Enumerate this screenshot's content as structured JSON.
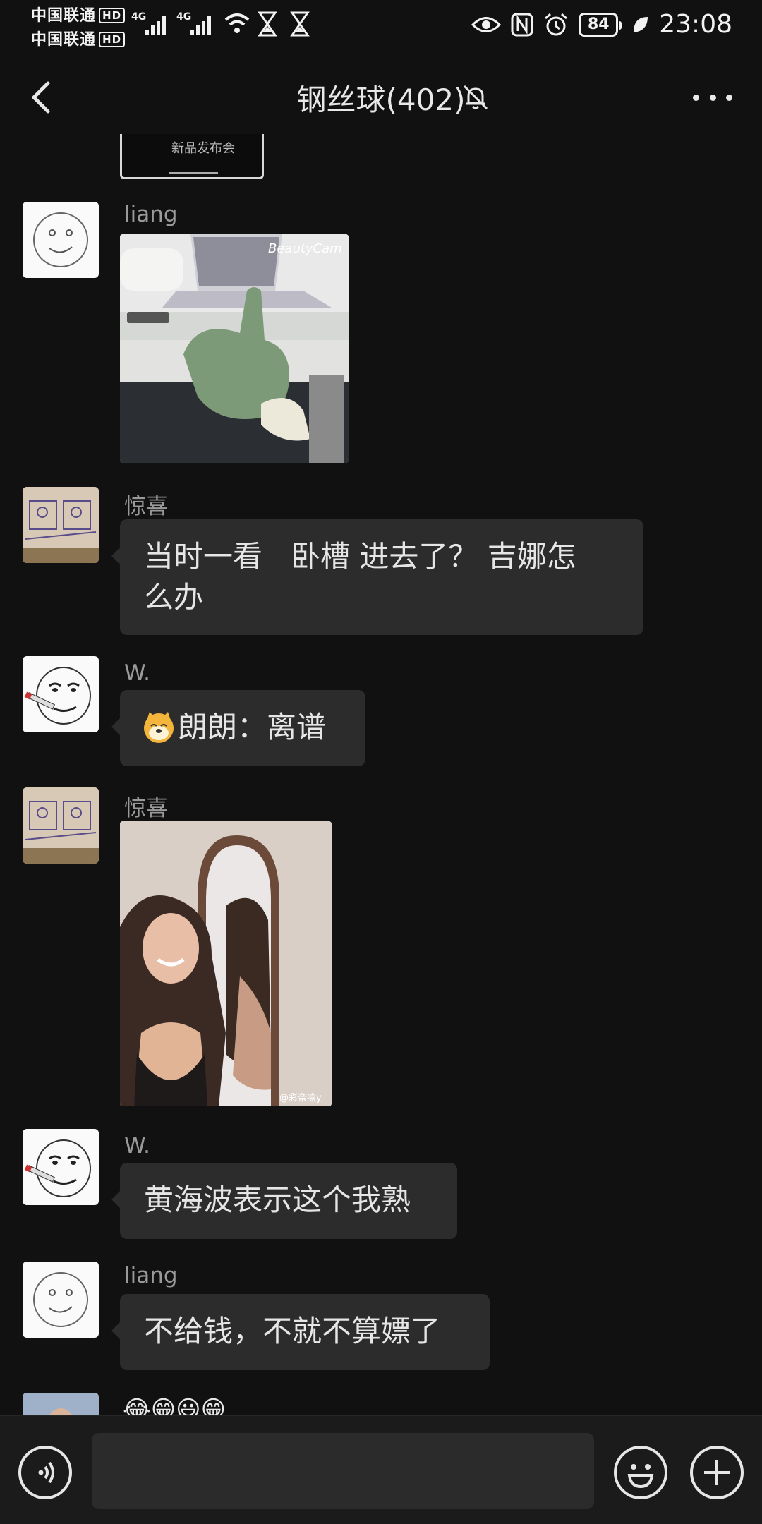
{
  "status_bar": {
    "carrier_1": "中国联通",
    "carrier_2": "中国联通",
    "hd_badge": "HD",
    "network_type": "4G",
    "battery": "84",
    "time": "23:08"
  },
  "header": {
    "title": "钢丝球(402)"
  },
  "messages": [
    {
      "sender": "liang",
      "type": "image"
    },
    {
      "sender": "惊喜",
      "type": "text",
      "text_line1": "当时一看   卧槽 进去了？ 吉娜怎",
      "text_line2": "么办"
    },
    {
      "sender": "W.",
      "type": "text",
      "text": "朗朗：离谱"
    },
    {
      "sender": "惊喜",
      "type": "image",
      "watermark": "@彩奈凛y"
    },
    {
      "sender": "W.",
      "type": "text",
      "text": "黄海波表示这个我熟"
    },
    {
      "sender": "liang",
      "type": "text",
      "text": "不给钱，不就不算嫖了"
    },
    {
      "type": "text",
      "text": "😂😁😃😁"
    }
  ],
  "image_overlays": {
    "top_partial_caption": "新品发布会",
    "beauty_watermark": "BeautyCam"
  },
  "input_bar": {
    "placeholder": ""
  },
  "icons": {
    "back": "back-arrow-icon",
    "mute": "bell-off-icon",
    "more": "more-dots-icon",
    "voice": "voice-icon",
    "emoji": "smiley-icon",
    "plus": "plus-icon"
  }
}
